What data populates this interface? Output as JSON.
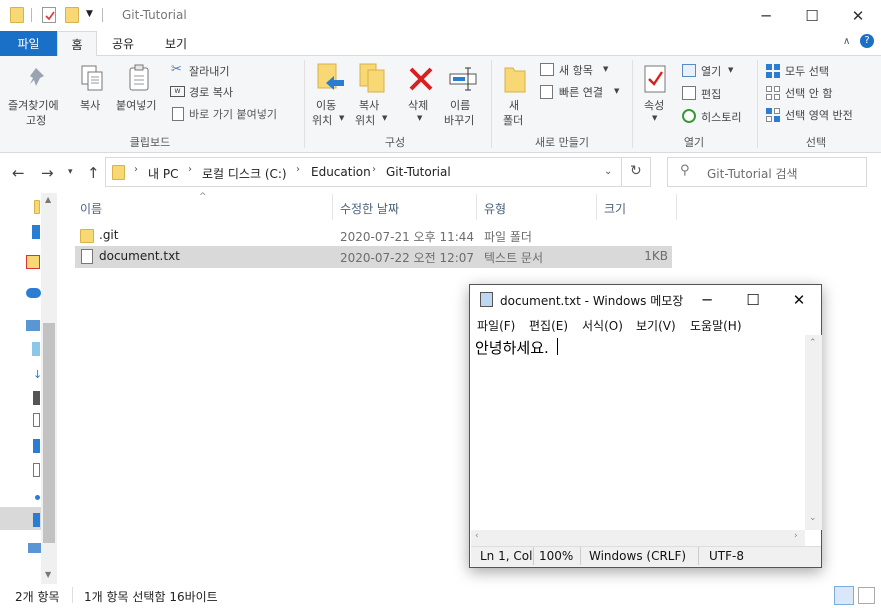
{
  "window": {
    "title": "Git-Tutorial"
  },
  "tabs": [
    {
      "label": "파일"
    },
    {
      "label": "홈"
    },
    {
      "label": "공유"
    },
    {
      "label": "보기"
    }
  ],
  "ribbon": {
    "clipboard": {
      "pin_label_1": "즐겨찾기에",
      "pin_label_2": "고정",
      "copy_label": "복사",
      "paste_label": "붙여넣기",
      "cut_label": "잘라내기",
      "copy_path_label": "경로 복사",
      "paste_shortcut_label": "바로 가기 붙여넣기",
      "group_label": "클립보드"
    },
    "organize": {
      "move_label_1": "이동",
      "move_label_2": "위치",
      "copyto_label_1": "복사",
      "copyto_label_2": "위치",
      "delete_label": "삭제",
      "rename_label_1": "이름",
      "rename_label_2": "바꾸기",
      "group_label": "구성"
    },
    "new": {
      "new_folder_label_1": "새",
      "new_folder_label_2": "폴더",
      "new_item_label": "새 항목",
      "easy_access_label": "빠른 연결",
      "group_label": "새로 만들기"
    },
    "open": {
      "properties_label": "속성",
      "open_label": "열기",
      "edit_label": "편집",
      "history_label": "히스토리",
      "group_label": "열기"
    },
    "select": {
      "select_all_label": "모두 선택",
      "select_none_label": "선택 안 함",
      "invert_label": "선택 영역 반전",
      "group_label": "선택"
    }
  },
  "address": {
    "crumbs": [
      "내 PC",
      "로컬 디스크 (C:)",
      "Education",
      "Git-Tutorial"
    ],
    "search_placeholder": "Git-Tutorial 검색"
  },
  "columns": {
    "name": "이름",
    "modified": "수정한 날짜",
    "type": "유형",
    "size": "크기"
  },
  "files": [
    {
      "name": ".git",
      "modified": "2020-07-21 오후 11:44",
      "type": "파일 폴더",
      "size": ""
    },
    {
      "name": "document.txt",
      "modified": "2020-07-22 오전 12:07",
      "type": "텍스트 문서",
      "size": "1KB"
    }
  ],
  "status": {
    "items": "2개 항목",
    "selected": "1개 항목 선택함 16바이트"
  },
  "notepad": {
    "title": "document.txt - Windows 메모장",
    "menu": [
      "파일(F)",
      "편집(E)",
      "서식(O)",
      "보기(V)",
      "도움말(H)"
    ],
    "content": "안녕하세요.",
    "status": {
      "position": "Ln 1, Col",
      "zoom": "100%",
      "eol": "Windows (CRLF)",
      "encoding": "UTF-8"
    }
  },
  "colors": {
    "accent": "#1a6fc7",
    "folder": "#f8d775",
    "selection": "#d9d9d9"
  }
}
